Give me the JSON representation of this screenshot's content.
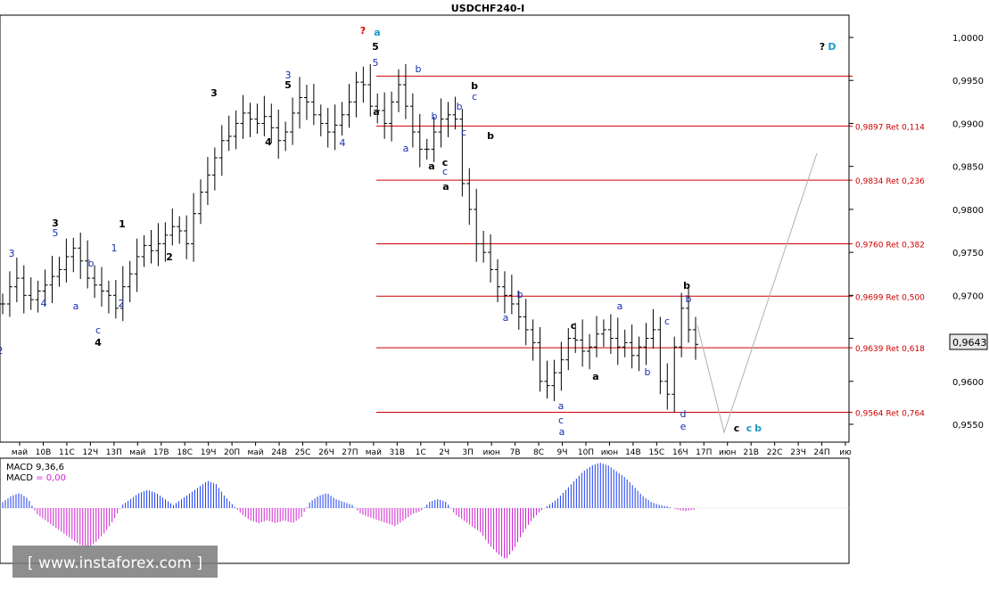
{
  "chart_data": {
    "type": "candlestick",
    "title": "USDCHF240-I",
    "price_axis": {
      "ylim": [
        0.9545,
        1.0018
      ],
      "ticks": [
        "1,0000",
        "0,9950",
        "0,9900",
        "0,9850",
        "0,9800",
        "0,9750",
        "0,9700",
        "0,9650",
        "0,9600",
        "0,9550"
      ],
      "current_price": "0,9643"
    },
    "time_axis_labels": [
      "май",
      "10В",
      "11С",
      "12Ч",
      "13П",
      "май",
      "17В",
      "18С",
      "19Ч",
      "20П",
      "май",
      "24В",
      "25С",
      "26Ч",
      "27П",
      "май",
      "31В",
      "1С",
      "2Ч",
      "3П",
      "июн",
      "7В",
      "8С",
      "9Ч",
      "10П",
      "июн",
      "14В",
      "15С",
      "16Ч",
      "17П",
      "июн",
      "21В",
      "22С",
      "23Ч",
      "24П",
      "ию"
    ],
    "price_series": [
      0.969,
      0.971,
      0.972,
      0.97,
      0.9695,
      0.9705,
      0.9712,
      0.9722,
      0.973,
      0.9745,
      0.9755,
      0.974,
      0.972,
      0.9712,
      0.9705,
      0.97,
      0.9685,
      0.971,
      0.9725,
      0.9745,
      0.9758,
      0.9752,
      0.976,
      0.977,
      0.978,
      0.9775,
      0.976,
      0.9795,
      0.982,
      0.984,
      0.986,
      0.988,
      0.9885,
      0.99,
      0.9912,
      0.9905,
      0.99,
      0.9908,
      0.9895,
      0.988,
      0.989,
      0.9912,
      0.993,
      0.9925,
      0.991,
      0.99,
      0.989,
      0.9898,
      0.991,
      0.9925,
      0.9948,
      0.9945,
      0.992,
      0.9915,
      0.99,
      0.9925,
      0.9945,
      0.992,
      0.989,
      0.987,
      0.987,
      0.989,
      0.9905,
      0.991,
      0.9905,
      0.983,
      0.98,
      0.976,
      0.975,
      0.973,
      0.971,
      0.97,
      0.969,
      0.9675,
      0.966,
      0.9645,
      0.96,
      0.9595,
      0.961,
      0.9625,
      0.965,
      0.9648,
      0.9635,
      0.964,
      0.9655,
      0.966,
      0.965,
      0.964,
      0.9645,
      0.963,
      0.964,
      0.965,
      0.966,
      0.96,
      0.9585,
      0.964,
      0.9685,
      0.966,
      0.9643
    ],
    "fib_levels": [
      {
        "price": 0.9955,
        "label": ""
      },
      {
        "price": 0.9897,
        "label": "0,9897 Ret 0,114"
      },
      {
        "price": 0.9834,
        "label": "0,9834 Ret 0,236"
      },
      {
        "price": 0.976,
        "label": "0,9760 Ret 0,382"
      },
      {
        "price": 0.9699,
        "label": "0,9699 Ret 0,500"
      },
      {
        "price": 0.9639,
        "label": "0,9639 Ret 0,618"
      },
      {
        "price": 0.9564,
        "label": "0,9564 Ret 0,764"
      }
    ],
    "macd": {
      "label": "MACD 9,36,6",
      "zero_label": "MACD = 0,00",
      "values": [
        0.2,
        0.4,
        0.5,
        0.3,
        -0.2,
        -0.4,
        -0.6,
        -0.8,
        -1.0,
        -1.2,
        -1.3,
        -1.1,
        -0.8,
        -0.4,
        0.1,
        0.3,
        0.5,
        0.6,
        0.5,
        0.3,
        0.1,
        0.3,
        0.5,
        0.7,
        0.9,
        0.8,
        0.4,
        0.1,
        -0.2,
        -0.4,
        -0.5,
        -0.4,
        -0.5,
        -0.4,
        -0.5,
        -0.3,
        0.2,
        0.4,
        0.5,
        0.3,
        0.2,
        0.1,
        -0.2,
        -0.3,
        -0.4,
        -0.5,
        -0.6,
        -0.4,
        -0.2,
        -0.1,
        0.2,
        0.3,
        0.2,
        -0.2,
        -0.4,
        -0.6,
        -0.8,
        -1.2,
        -1.5,
        -1.7,
        -1.3,
        -0.8,
        -0.4,
        -0.1,
        0.1,
        0.3,
        0.6,
        0.9,
        1.2,
        1.4,
        1.5,
        1.4,
        1.2,
        1.0,
        0.7,
        0.4,
        0.2,
        0.1,
        0.05,
        -0.05,
        -0.1,
        -0.05
      ]
    },
    "wave_labels": [
      {
        "text": "2",
        "color": "#1a2fb0"
      },
      {
        "text": "3",
        "color": "#1a2fb0"
      },
      {
        "text": "4",
        "color": "#1a2fb0"
      },
      {
        "text": "3",
        "color": "#000000"
      },
      {
        "text": "5",
        "color": "#1a2fb0"
      },
      {
        "text": "b",
        "color": "#1a2fb0"
      },
      {
        "text": "a",
        "color": "#1a2fb0"
      },
      {
        "text": "c",
        "color": "#1a2fb0"
      },
      {
        "text": "4",
        "color": "#000000"
      },
      {
        "text": "1",
        "color": "#1a2fb0"
      },
      {
        "text": "2",
        "color": "#1a2fb0"
      },
      {
        "text": "1",
        "color": "#000000"
      },
      {
        "text": "2",
        "color": "#000000"
      },
      {
        "text": "3",
        "color": "#000000"
      },
      {
        "text": "4",
        "color": "#000000"
      },
      {
        "text": "3",
        "color": "#1a2fb0"
      },
      {
        "text": "5",
        "color": "#000000"
      },
      {
        "text": "4",
        "color": "#1a2fb0"
      },
      {
        "text": "?",
        "color": "#e00000"
      },
      {
        "text": "a",
        "color": "#1a9ac8"
      },
      {
        "text": "5",
        "color": "#000000"
      },
      {
        "text": "5",
        "color": "#1a2fb0"
      },
      {
        "text": "a",
        "color": "#000000"
      },
      {
        "text": "b",
        "color": "#1a2fb0"
      },
      {
        "text": "b",
        "color": "#000000"
      },
      {
        "text": "c",
        "color": "#1a2fb0"
      },
      {
        "text": "a",
        "color": "#1a2fb0"
      },
      {
        "text": "a",
        "color": "#000000"
      },
      {
        "text": "b",
        "color": "#1a2fb0"
      },
      {
        "text": "c",
        "color": "#000000"
      },
      {
        "text": "c",
        "color": "#1a2fb0"
      },
      {
        "text": "a",
        "color": "#000000"
      },
      {
        "text": "b",
        "color": "#000000"
      },
      {
        "text": "c",
        "color": "#1a2fb0"
      },
      {
        "text": "b",
        "color": "#1a2fb0"
      },
      {
        "text": "a",
        "color": "#1a2fb0"
      },
      {
        "text": "b",
        "color": "#1a2fb0"
      },
      {
        "text": "a",
        "color": "#1a2fb0"
      },
      {
        "text": "c",
        "color": "#1a2fb0"
      },
      {
        "text": "c",
        "color": "#000000"
      },
      {
        "text": "a",
        "color": "#1a2fb0"
      },
      {
        "text": "a",
        "color": "#000000"
      },
      {
        "text": "a",
        "color": "#1a2fb0"
      },
      {
        "text": "b",
        "color": "#1a2fb0"
      },
      {
        "text": "c",
        "color": "#1a2fb0"
      },
      {
        "text": "d",
        "color": "#1a2fb0"
      },
      {
        "text": "e",
        "color": "#1a2fb0"
      },
      {
        "text": "b",
        "color": "#000000"
      },
      {
        "text": "b",
        "color": "#1a2fb0"
      },
      {
        "text": "c",
        "color": "#000000"
      },
      {
        "text": "c",
        "color": "#1a9ac8"
      },
      {
        "text": "b",
        "color": "#1a9ac8"
      },
      {
        "text": "?",
        "color": "#000000"
      },
      {
        "text": "D",
        "color": "#1a9ac8"
      },
      {
        "text": "C",
        "color": "#e00000"
      }
    ]
  },
  "watermark": "[ www.instaforex.com ]",
  "colors": {
    "fib_line": "#cc0000",
    "fib_label": "#cc0000",
    "candle": "#000000",
    "macd_positive": "#1a3cf0",
    "macd_negative": "#d020d0",
    "forecast_line": "#b0b0b0",
    "price_box": "#e8e8e8"
  }
}
